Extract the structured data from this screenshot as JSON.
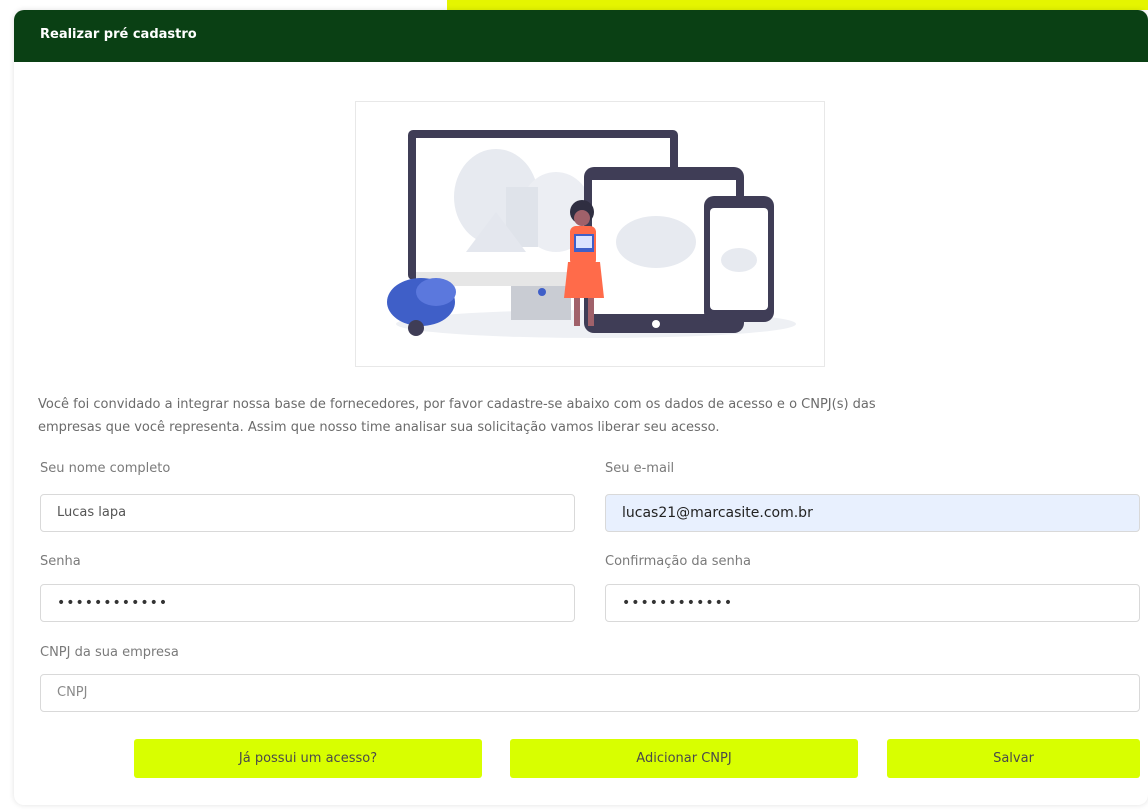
{
  "header": {
    "title": "Realizar pré cadastro"
  },
  "intro": {
    "line1": "Você foi convidado a integrar nossa base de fornecedores, por favor cadastre-se abaixo com os dados de acesso e o CNPJ(s) das",
    "line2": "empresas que você representa. Assim que nosso time analisar sua solicitação vamos liberar seu acesso."
  },
  "form": {
    "name": {
      "label": "Seu nome completo",
      "value": "Lucas lapa"
    },
    "email": {
      "label": "Seu e-mail",
      "value": "lucas21@marcasite.com.br"
    },
    "password": {
      "label": "Senha",
      "value": "••••••••••••"
    },
    "password_confirm": {
      "label": "Confirmação da senha",
      "value": "••••••••••••"
    },
    "cnpj": {
      "label": "CNPJ da sua empresa",
      "placeholder": "CNPJ"
    }
  },
  "buttons": {
    "login": "Já possui um acesso?",
    "add_cnpj": "Adicionar CNPJ",
    "save": "Salvar"
  },
  "colors": {
    "header_bg": "#0a4014",
    "accent": "#d8ff00",
    "autofill_bg": "#e8f0fe"
  },
  "icons": {
    "illustration": "devices-illustration"
  }
}
